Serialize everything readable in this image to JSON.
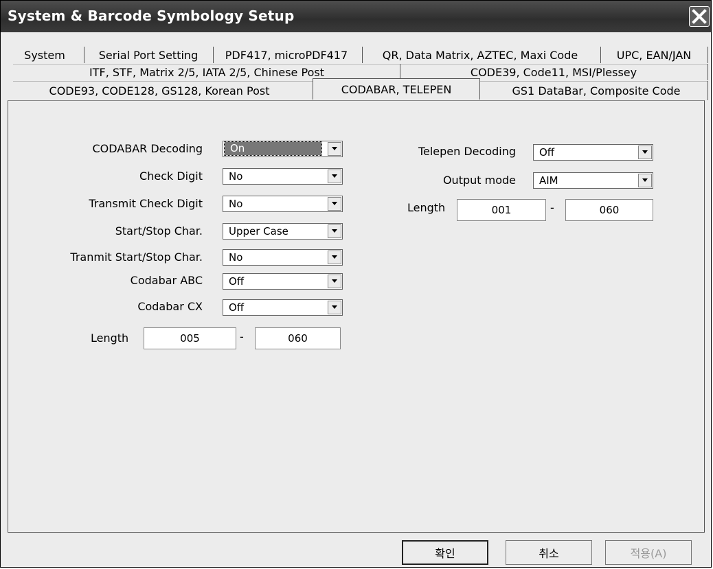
{
  "window": {
    "title": "System & Barcode Symbology Setup"
  },
  "tabs": {
    "row1": [
      "System",
      "Serial Port Setting",
      "PDF417, microPDF417",
      "QR, Data Matrix, AZTEC, Maxi Code",
      "UPC, EAN/JAN"
    ],
    "row2": [
      "ITF, STF, Matrix 2/5, IATA 2/5, Chinese Post",
      "CODE39, Code11, MSI/Plessey"
    ],
    "row3": [
      "CODE93, CODE128, GS128, Korean Post",
      "CODABAR, TELEPEN",
      "GS1 DataBar, Composite Code"
    ],
    "active": "CODABAR, TELEPEN"
  },
  "codabar": {
    "decoding": {
      "label": "CODABAR Decoding",
      "value": "On"
    },
    "check_digit": {
      "label": "Check Digit",
      "value": "No"
    },
    "transmit_check_digit": {
      "label": "Transmit Check Digit",
      "value": "No"
    },
    "start_stop_char": {
      "label": "Start/Stop Char.",
      "value": "Upper Case"
    },
    "transmit_start_stop": {
      "label": "Tranmit Start/Stop Char.",
      "value": "No"
    },
    "abc": {
      "label": "Codabar ABC",
      "value": "Off"
    },
    "cx": {
      "label": "Codabar CX",
      "value": "Off"
    },
    "length": {
      "label": "Length",
      "min": "005",
      "max": "060",
      "separator": "-"
    }
  },
  "telepen": {
    "decoding": {
      "label": "Telepen Decoding",
      "value": "Off"
    },
    "output_mode": {
      "label": "Output mode",
      "value": "AIM"
    },
    "length": {
      "label": "Length",
      "min": "001",
      "max": "060",
      "separator": "-"
    }
  },
  "buttons": {
    "ok": "확인",
    "cancel": "취소",
    "apply": "적용(A)"
  },
  "icons": {
    "close": "close-icon",
    "dropdown": "chevron-down-icon"
  }
}
